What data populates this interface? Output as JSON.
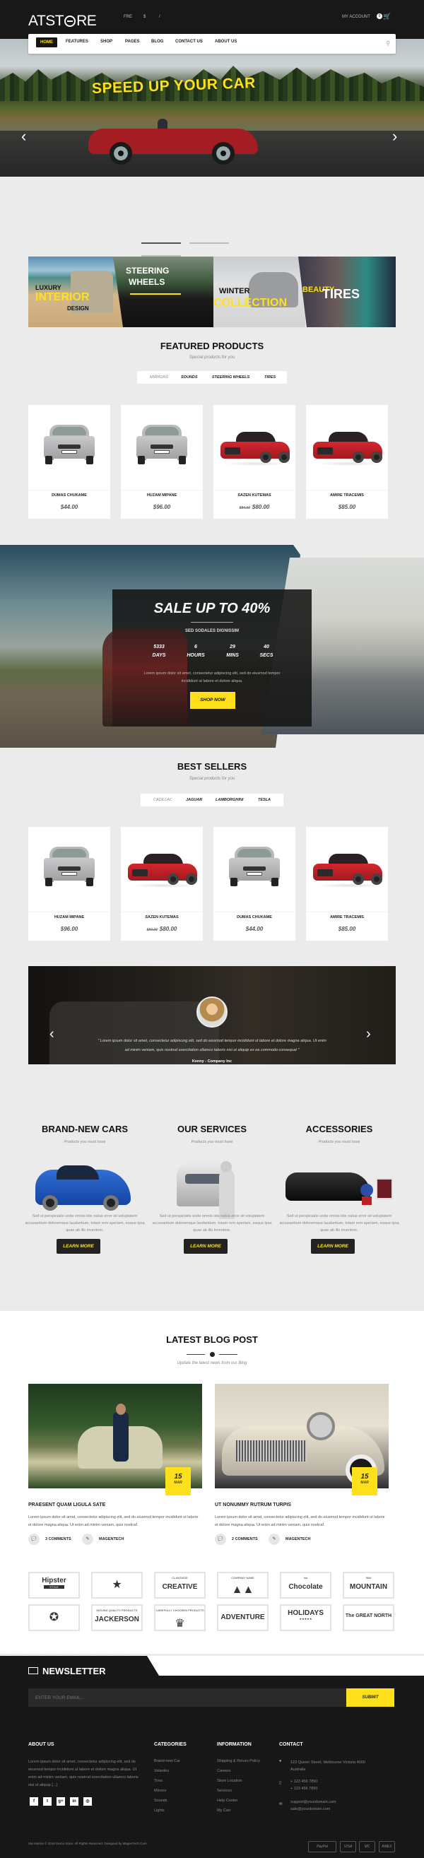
{
  "header": {
    "logo": "ATSTORE",
    "lang": "FRE",
    "currency": "$",
    "divider": "/",
    "account": "MY ACCOUNT",
    "cart_count": "0"
  },
  "nav": {
    "items": [
      "HOME",
      "FEATURES",
      "SHOP",
      "PAGES",
      "BLOG",
      "CONTACT US",
      "ABOUT US"
    ],
    "active": "HOME"
  },
  "hero": {
    "slogan": "SPEED UP YOUR CAR",
    "slides": 3,
    "active_slide": 1
  },
  "banners": [
    {
      "line1": "LUXURY",
      "line2": "INTERIOR",
      "line3": "DESIGN"
    },
    {
      "line1": "STEERING",
      "line2": "WHEELS"
    },
    {
      "line1": "WINTER",
      "line2": "COLLECTION"
    },
    {
      "line1": "BEAUTY",
      "line2": "TIRES"
    }
  ],
  "featured": {
    "title": "FEATURED PRODUCTS",
    "subtitle": "Special products for you",
    "tabs": [
      "MIRRORS",
      "SOUNDS",
      "STEERING WHEELS",
      "TIRES"
    ],
    "products": [
      {
        "name": "DUMAS CHUKAME",
        "price": "$44.00",
        "old_price": "",
        "color": "silver"
      },
      {
        "name": "HUZAM MIPANE",
        "price": "$96.00",
        "old_price": "",
        "color": "silver"
      },
      {
        "name": "SAZEN KUTEMAS",
        "price": "$80.00",
        "old_price": "$84.00",
        "color": "red"
      },
      {
        "name": "AMIRE TRACEMIS",
        "price": "$85.00",
        "old_price": "",
        "color": "red"
      }
    ]
  },
  "sale": {
    "title": "SALE UP TO 40%",
    "subtitle": "SED SODALES DIGNISSIM",
    "countdown": [
      {
        "value": "5333",
        "unit": "DAYS"
      },
      {
        "value": "6",
        "unit": "HOURS"
      },
      {
        "value": "29",
        "unit": "MINS"
      },
      {
        "value": "40",
        "unit": "SECS"
      }
    ],
    "description": "Lorem ipsum dolor sit amet, consectetur adipiscing elit, sed do eiusmod tempor incididunt ut labore et dolore aliqua.",
    "button": "SHOP NOW"
  },
  "bestsellers": {
    "title": "BEST SELLERS",
    "subtitle": "Special products for you",
    "tabs": [
      "CADILLAC",
      "JAGUAR",
      "LAMBORGHINI",
      "TESLA"
    ],
    "products": [
      {
        "name": "HUZAM MIPANE",
        "price": "$96.00",
        "old_price": "",
        "color": "silver"
      },
      {
        "name": "SAZEN KUTEMAS",
        "price": "$80.00",
        "old_price": "$84.00",
        "color": "red"
      },
      {
        "name": "DUMAS CHUKAME",
        "price": "$44.00",
        "old_price": "",
        "color": "silver"
      },
      {
        "name": "AMIRE TRACEMIS",
        "price": "$85.00",
        "old_price": "",
        "color": "red"
      }
    ]
  },
  "testimonial": {
    "quote": "\" Lorem ipsum dolor sit amet, consectetur adipiscing elit, sed do eiusmod tempor incididunt ut labore et dolore magna aliqua. Ut enim ad minim veniam, quis nostrud exercitation ullamco laboris nisi ut aliquip ex ea commodo consequat \"",
    "author": "Kenny - Company Inc"
  },
  "services": [
    {
      "title": "BRAND-NEW CARS",
      "subtitle": "Products you must have",
      "text": "Sed ut perspiciatis unde omnis iste natus error sit voluptatem accusantium doloremque laudantium, totam rem aperiam, eaque ipsa quae ab illo inventore.",
      "button": "LEARN MORE"
    },
    {
      "title": "OUR SERVICES",
      "subtitle": "Products you must have",
      "text": "Sed ut perspiciatis unde omnis iste natus error sit voluptatem accusantium doloremque laudantium, totam rem aperiam, eaque ipsa quae ab illo inventore.",
      "button": "LEARN MORE"
    },
    {
      "title": "ACCESSORIES",
      "subtitle": "Products you must have",
      "text": "Sed ut perspiciatis unde omnis iste natus error sit voluptatem accusantium doloremque laudantium, totam rem aperiam, eaque ipsa quae ab illo inventore.",
      "button": "LEARN MORE"
    }
  ],
  "blog": {
    "title": "LATEST BLOG POST",
    "subtitle": "Update the latest news from our Blog",
    "posts": [
      {
        "day": "15",
        "month": "MAR",
        "title": "PRAESENT QUAM LIGULA SATE",
        "excerpt": "Lorem ipsum dolor sit amet, consectetur adipiscing elit, sed do eiusmod tempor incididunt ut labore et dolore magna aliqua. Ut enim ad minim veniam, quis nostrud",
        "comments": "3 COMMENTS",
        "author": "MAGENTECH"
      },
      {
        "day": "15",
        "month": "MAR",
        "title": "UT NONUMMY RUTRUM TURPIS",
        "excerpt": "Lorem ipsum dolor sit amet, consectetur adipiscing elit, sed do eiusmod tempor incididunt ut labore et dolore magna aliqua. Ut enim ad minim veniam, quis nostrud",
        "comments": "2 COMMENTS",
        "author": "MAGENTECH"
      }
    ]
  },
  "brands": [
    {
      "main": "Hipster",
      "sub": "STYLE"
    },
    {
      "main": "★",
      "sub": ""
    },
    {
      "main": "CREATIVE",
      "sub": "CLANTASID"
    },
    {
      "main": "▲▲",
      "sub": "COMPANY NAME"
    },
    {
      "main": "Chocolate",
      "sub": "hot"
    },
    {
      "main": "MOUNTAIN",
      "sub": "Wild"
    },
    {
      "main": "✪",
      "sub": ""
    },
    {
      "main": "JACKERSON",
      "sub": "MOVING QUALITY PRODUCTS"
    },
    {
      "main": "♛",
      "sub": "CAREFULLY CHOOSEN PRODUCTS"
    },
    {
      "main": "ADVENTURE",
      "sub": ""
    },
    {
      "main": "HOLIDAYS",
      "sub": "★★★★★"
    },
    {
      "main": "The GREAT NORTH",
      "sub": ""
    }
  ],
  "newsletter": {
    "title": "NEWSLETTER",
    "placeholder": "ENTER YOUR EMAIL...",
    "button": "SUBMIT"
  },
  "footer": {
    "about": {
      "title": "ABOUT US",
      "text": "Lorem ipsum dolor sit amet, consectetur adipiscing elit, sed do eiusmod tempor incididunt ut labore et dolore magna aliqua. Ut enim ad minim veniam, quis nostrud exercitation ullamco laboris nisi ut aliquip [...]",
      "social": [
        "f",
        "t",
        "g+",
        "in",
        "◎"
      ]
    },
    "categories": {
      "title": "CATEGORIES",
      "items": [
        "Brand-new Car",
        "Volantes",
        "Tires",
        "Mirrors",
        "Sounds",
        "Lights"
      ]
    },
    "information": {
      "title": "INFORMATION",
      "items": [
        "Shipping & Return Policy",
        "Careers",
        "Store Location",
        "Services",
        "Help Center",
        "My Cart"
      ]
    },
    "contact": {
      "title": "CONTACT",
      "address": "123 Queen Street, Melbourne Victoria 4000 Australia",
      "phone1": "+ 123 456 7890",
      "phone2": "+ 123 456 7890",
      "email1": "support@yourdomain.com",
      "email2": "sale@yourdomain.com"
    },
    "copyright": "SM Atstore © 2016 Demo Store. All Rights Reserved. Designed by MagenTech.Com",
    "payments": [
      "PayPal",
      "VISA",
      "MC",
      "AMEX"
    ]
  },
  "colors": {
    "accent": "#ffe01b",
    "dark": "#161616",
    "bg": "#ebebeb"
  }
}
